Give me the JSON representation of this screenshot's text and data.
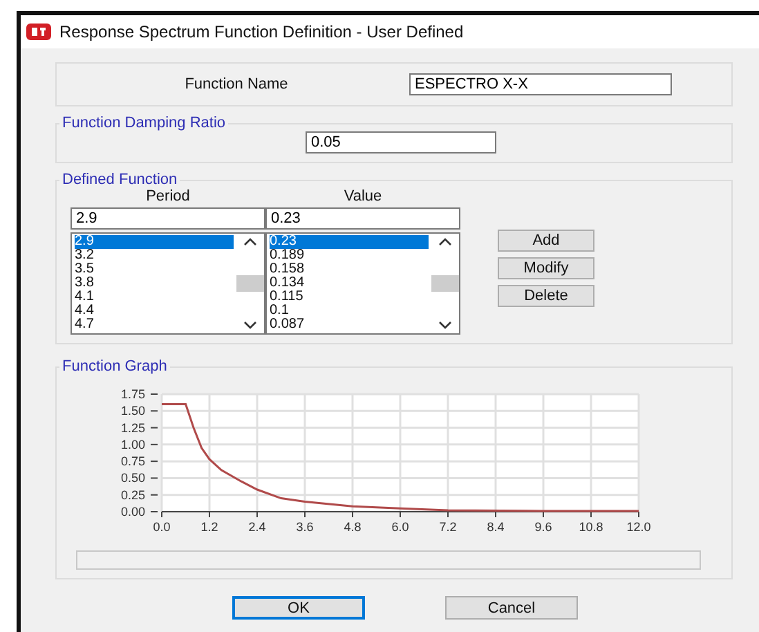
{
  "window": {
    "title": "Response Spectrum Function Definition - User Defined"
  },
  "function_name": {
    "label": "Function Name",
    "value": "ESPECTRO X-X"
  },
  "damping": {
    "title": "Function Damping Ratio",
    "value": "0.05"
  },
  "defined_function": {
    "title": "Defined Function",
    "columns": [
      "Period",
      "Value"
    ],
    "period_value": "2.9",
    "value_value": "0.23",
    "periods": [
      {
        "text": "2.9",
        "selected": true
      },
      {
        "text": "3.2",
        "selected": false
      },
      {
        "text": "3.5",
        "selected": false
      },
      {
        "text": "3.8",
        "selected": false
      },
      {
        "text": "4.1",
        "selected": false
      },
      {
        "text": "4.4",
        "selected": false
      },
      {
        "text": "4.7",
        "selected": false
      }
    ],
    "values": [
      {
        "text": "0.23",
        "selected": true
      },
      {
        "text": "0.189",
        "selected": false
      },
      {
        "text": "0.158",
        "selected": false
      },
      {
        "text": "0.134",
        "selected": false
      },
      {
        "text": "0.115",
        "selected": false
      },
      {
        "text": "0.1",
        "selected": false
      },
      {
        "text": "0.087",
        "selected": false
      }
    ],
    "buttons": [
      "Add",
      "Modify",
      "Delete"
    ]
  },
  "graph": {
    "title": "Function Graph",
    "chart_data": {
      "type": "line",
      "x": [
        0,
        0.6,
        0.8,
        1.0,
        1.2,
        1.5,
        2.0,
        2.4,
        3.0,
        3.6,
        4.8,
        6.0,
        7.2,
        9.6,
        12.0
      ],
      "grid": true,
      "series": [
        {
          "color": "#b04a4a",
          "values": [
            1.6,
            1.6,
            1.25,
            0.95,
            0.78,
            0.62,
            0.45,
            0.33,
            0.2,
            0.15,
            0.08,
            0.05,
            0.02,
            0.01,
            0.01
          ]
        }
      ],
      "xlim": [
        0,
        12
      ],
      "ylim": [
        0,
        1.75
      ],
      "xticks": [
        {
          "value": 0,
          "label": "0.0"
        },
        {
          "value": 1.2,
          "label": "1.2"
        },
        {
          "value": 2.4,
          "label": "2.4"
        },
        {
          "value": 3.6,
          "label": "3.6"
        },
        {
          "value": 4.8,
          "label": "4.8"
        },
        {
          "value": 6,
          "label": "6.0"
        },
        {
          "value": 7.2,
          "label": "7.2"
        },
        {
          "value": 8.4,
          "label": "8.4"
        },
        {
          "value": 9.6,
          "label": "9.6"
        },
        {
          "value": 10.8,
          "label": "10.8"
        },
        {
          "value": 12,
          "label": "12.0"
        }
      ],
      "yticks": [
        {
          "value": 0,
          "label": "0.00"
        },
        {
          "value": 0.25,
          "label": "0.25"
        },
        {
          "value": 0.5,
          "label": "0.50"
        },
        {
          "value": 0.75,
          "label": "0.75"
        },
        {
          "value": 1,
          "label": "1.00"
        },
        {
          "value": 1.25,
          "label": "1.25"
        },
        {
          "value": 1.5,
          "label": "1.50"
        },
        {
          "value": 1.75,
          "label": "1.75"
        }
      ]
    }
  },
  "footer_buttons": [
    "OK",
    "Cancel"
  ]
}
